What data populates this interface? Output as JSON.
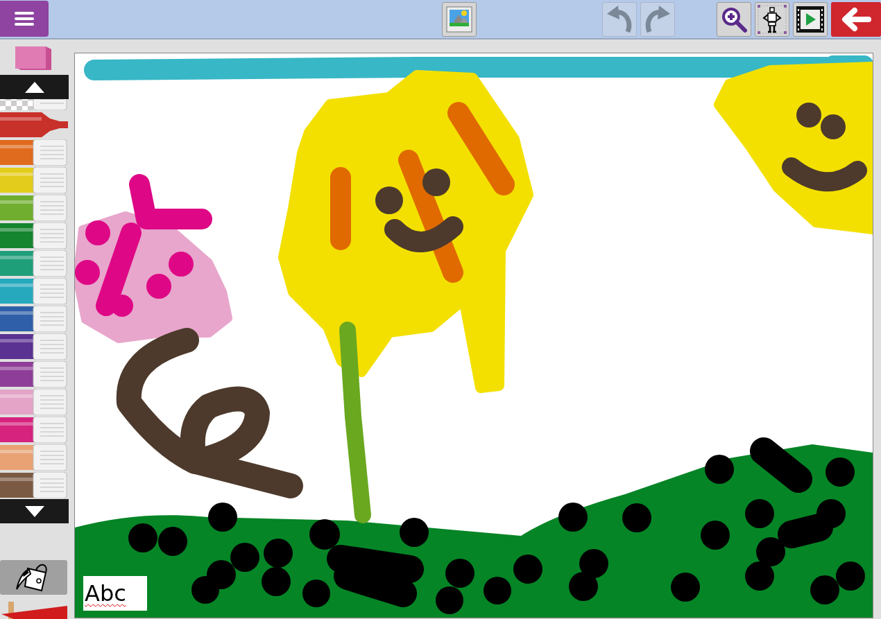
{
  "toolbar": {
    "undo": {
      "disabled": true
    },
    "redo": {
      "disabled": true
    }
  },
  "palette": {
    "markers": [
      {
        "kind": "transparent",
        "selected": false
      },
      {
        "kind": "marker",
        "color": "#c8302a",
        "selected": true
      },
      {
        "kind": "marker",
        "color": "#e06a1e",
        "selected": false
      },
      {
        "kind": "marker",
        "color": "#e4cc1c",
        "selected": false
      },
      {
        "kind": "marker",
        "color": "#6fae2e",
        "selected": false
      },
      {
        "kind": "marker",
        "color": "#16852f",
        "selected": false
      },
      {
        "kind": "marker",
        "color": "#1f9e7a",
        "selected": false
      },
      {
        "kind": "marker",
        "color": "#27a9bd",
        "selected": false
      },
      {
        "kind": "marker",
        "color": "#2f5fa8",
        "selected": false
      },
      {
        "kind": "marker",
        "color": "#5a3292",
        "selected": false
      },
      {
        "kind": "marker",
        "color": "#8e3e98",
        "selected": false
      },
      {
        "kind": "marker",
        "color": "#e3a4c8",
        "selected": false
      },
      {
        "kind": "marker",
        "color": "#d6237e",
        "selected": false
      },
      {
        "kind": "marker",
        "color": "#e9a274",
        "selected": false
      },
      {
        "kind": "marker",
        "color": "#7b5a44",
        "selected": false
      }
    ]
  },
  "canvas": {
    "text_box": {
      "value": "Abc"
    }
  }
}
